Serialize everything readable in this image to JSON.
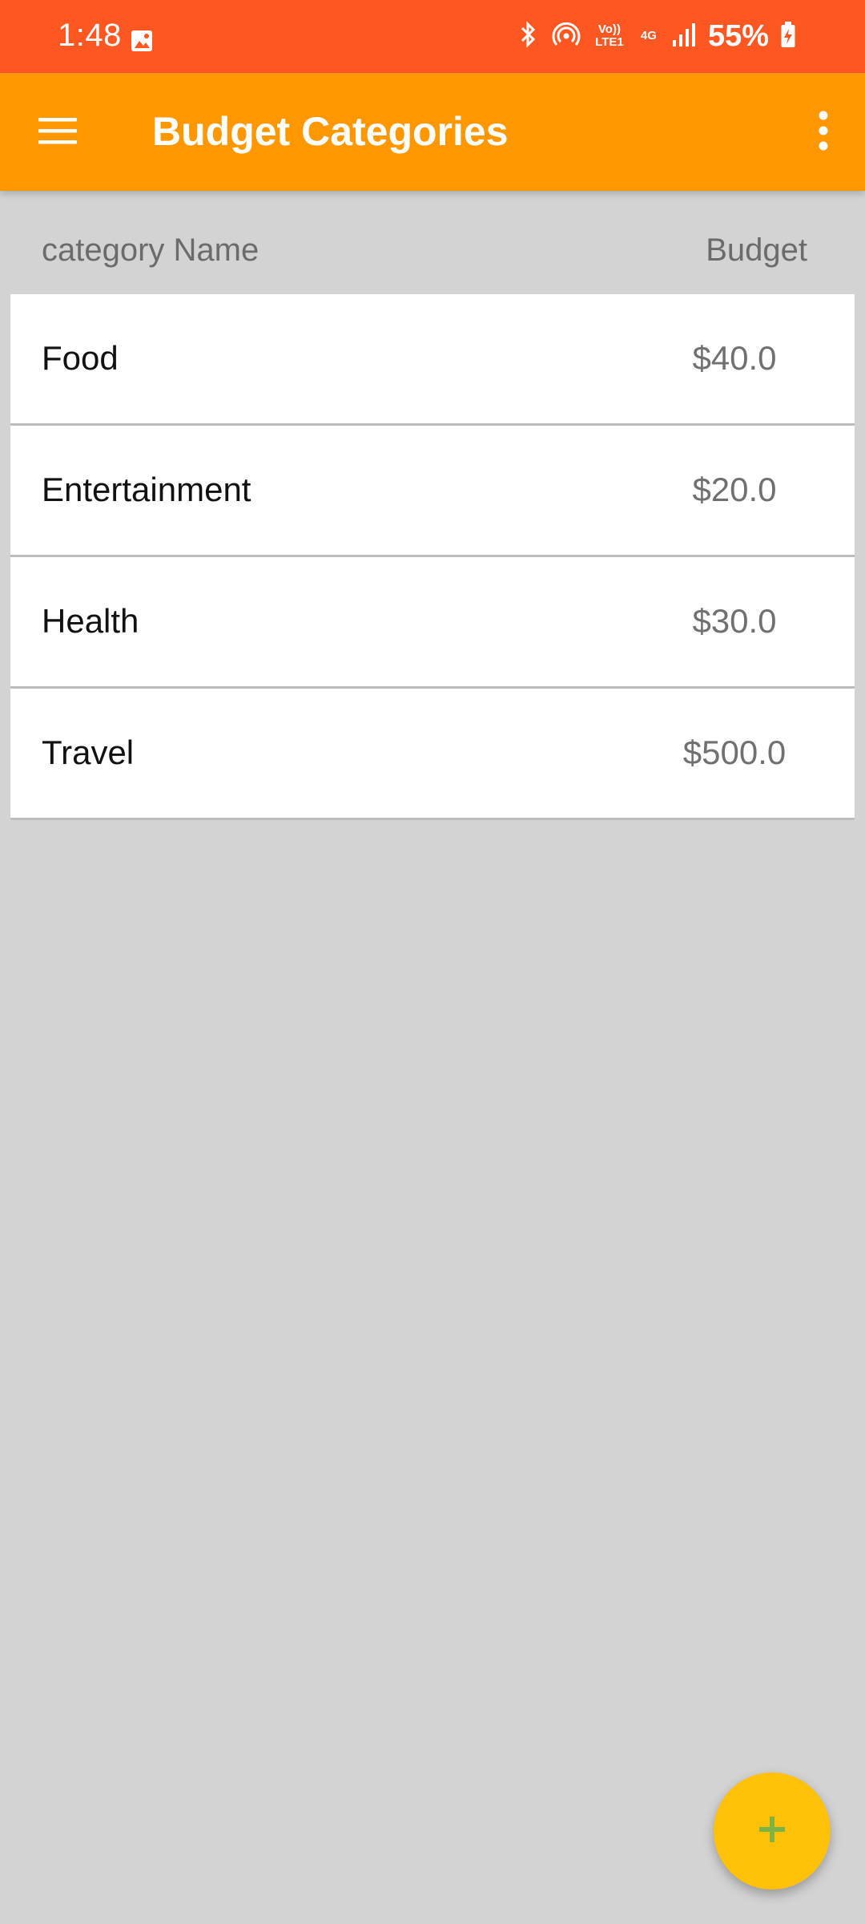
{
  "status_bar": {
    "time": "1:48",
    "volte_label": "Vo)) LTE1",
    "network_label": "4G",
    "battery": "55%",
    "color": "#ff5722"
  },
  "app_bar": {
    "title": "Budget Categories",
    "menu_icon": "menu-icon",
    "more_icon": "more-vert-icon",
    "color": "#ff9800"
  },
  "table": {
    "headers": {
      "name": "category Name",
      "budget": "Budget"
    },
    "rows": [
      {
        "name": "Food",
        "budget": "$40.0"
      },
      {
        "name": "Entertainment",
        "budget": "$20.0"
      },
      {
        "name": "Health",
        "budget": "$30.0"
      },
      {
        "name": "Travel",
        "budget": "$500.0"
      }
    ]
  },
  "fab": {
    "icon": "add-icon",
    "color": "#ffc107",
    "icon_color": "#7cb342"
  }
}
